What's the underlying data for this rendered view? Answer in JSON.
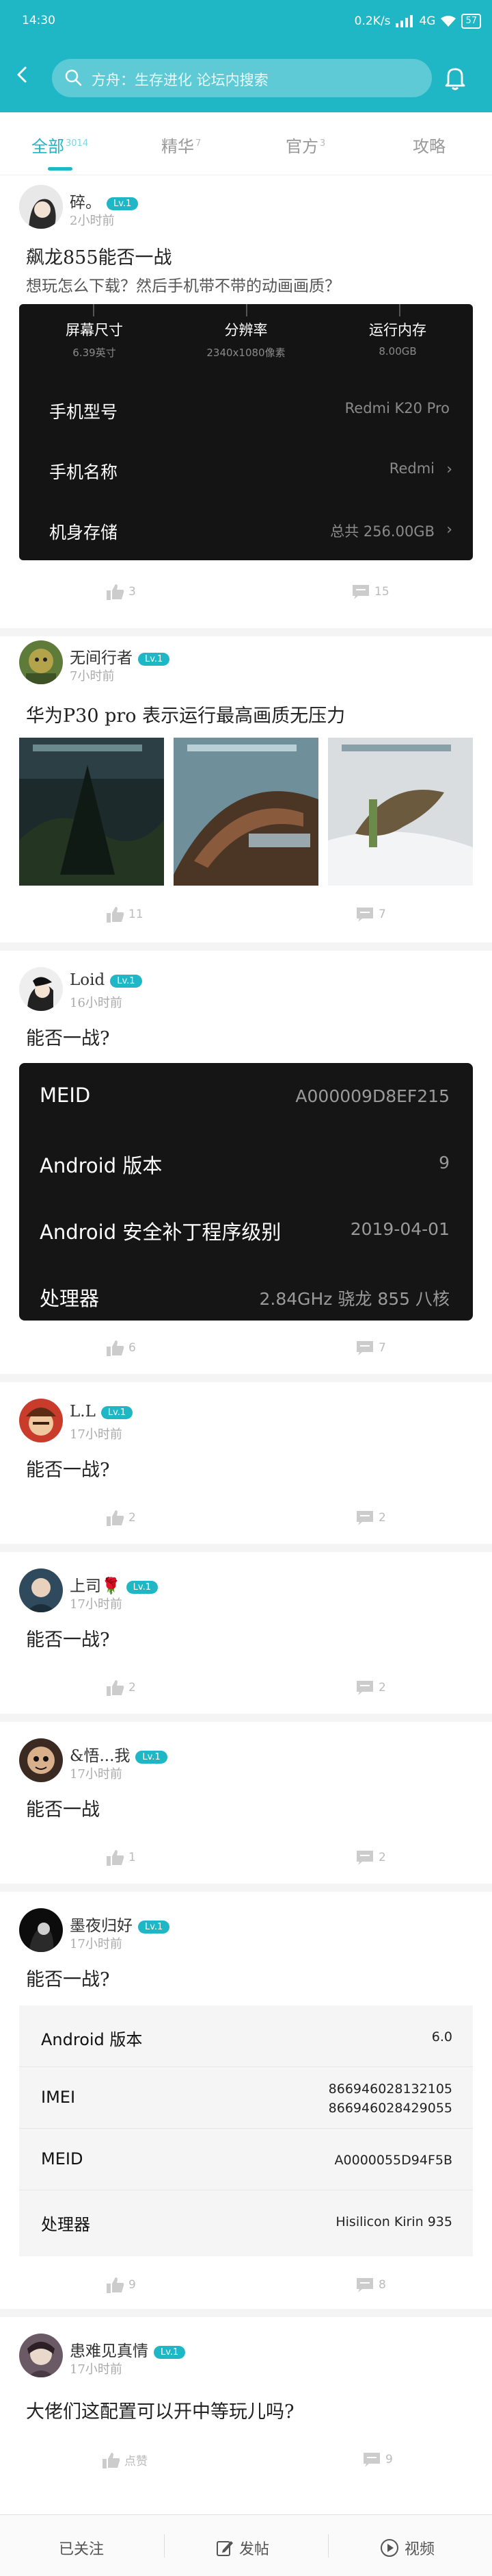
{
  "status_bar": {
    "time": "14:30",
    "network": "0.2K/s",
    "signal": "4G",
    "battery": "57"
  },
  "header": {
    "search_placeholder": "方舟：生存进化 论坛内搜索"
  },
  "tabs": [
    {
      "label": "全部",
      "count": "3014"
    },
    {
      "label": "精华",
      "count": "7"
    },
    {
      "label": "官方",
      "count": "3"
    },
    {
      "label": "攻略",
      "count": ""
    }
  ],
  "posts": [
    {
      "author": "碎。",
      "level": "Lv.1",
      "time": "2小时前",
      "title": "飙龙855能否一战",
      "body": "想玩怎么下载？然后手机带不带的动画画质？",
      "likes": "3",
      "comments": "15",
      "spec_card": {
        "columns": [
          {
            "title": "屏幕尺寸",
            "value": "6.39英寸"
          },
          {
            "title": "分辨率",
            "value": "2340x1080像素"
          },
          {
            "title": "运行内存",
            "value": "8.00GB"
          }
        ],
        "rows": [
          {
            "label": "手机型号",
            "value": "Redmi K20 Pro",
            "chevron": false
          },
          {
            "label": "手机名称",
            "value": "Redmi",
            "chevron": true
          },
          {
            "label": "机身存储",
            "value": "总共 256.00GB",
            "chevron": true
          }
        ]
      }
    },
    {
      "author": "无间行者",
      "level": "Lv.1",
      "time": "7小时前",
      "title": "华为P30 pro 表示运行最高画质无压力",
      "likes": "11",
      "comments": "7"
    },
    {
      "author": "Loid",
      "level": "Lv.1",
      "time": "16小时前",
      "title": "能否一战?",
      "likes": "6",
      "comments": "7",
      "device_card": [
        {
          "label": "MEID",
          "value": "A000009D8EF215"
        },
        {
          "label": "Android 版本",
          "value": "9"
        },
        {
          "label": "Android 安全补丁程序级别",
          "value": "2019-04-01"
        },
        {
          "label": "处理器",
          "value": "2.84GHz 骁龙 855 八核"
        }
      ]
    },
    {
      "author": "L.L",
      "level": "Lv.1",
      "time": "17小时前",
      "title": "能否一战?",
      "likes": "2",
      "comments": "2"
    },
    {
      "author": "上司🌹",
      "level": "Lv.1",
      "time": "17小时前",
      "title": "能否一战?",
      "likes": "2",
      "comments": "2"
    },
    {
      "author": "&悟...我",
      "level": "Lv.1",
      "time": "17小时前",
      "title": "能否一战",
      "likes": "1",
      "comments": "2"
    },
    {
      "author": "墨夜归好",
      "level": "Lv.1",
      "time": "17小时前",
      "title": "能否一战?",
      "likes": "9",
      "comments": "8",
      "info_card": [
        {
          "label": "Android 版本",
          "value": "6.0"
        },
        {
          "label": "IMEI",
          "value": "866946028132105\n866946028429055"
        },
        {
          "label": "MEID",
          "value": "A0000055D94F5B"
        },
        {
          "label": "处理器",
          "value": "Hisilicon Kirin 935"
        }
      ]
    },
    {
      "author": "患难见真情",
      "level": "Lv.1",
      "time": "17小时前",
      "title": "大佬们这配置可以开中等玩儿吗?",
      "likes": "点赞",
      "comments": "9"
    }
  ],
  "bottom_bar": {
    "follow": "已关注",
    "post": "发帖",
    "video": "视频"
  }
}
